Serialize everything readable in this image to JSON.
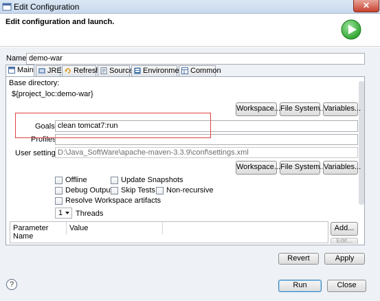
{
  "window": {
    "title": "Edit Configuration",
    "close_glyph": "✕"
  },
  "header": {
    "title": "Edit configuration and launch."
  },
  "name": {
    "label": "Name:",
    "value": "demo-war"
  },
  "tabs": [
    {
      "label": "Main",
      "icon": "main-tab-icon"
    },
    {
      "label": "JRE",
      "icon": "jre-tab-icon"
    },
    {
      "label": "Refresh",
      "icon": "refresh-tab-icon"
    },
    {
      "label": "Source",
      "icon": "source-tab-icon"
    },
    {
      "label": "Environment",
      "icon": "environment-tab-icon"
    },
    {
      "label": "Common",
      "icon": "common-tab-icon"
    }
  ],
  "main": {
    "base_dir_label": "Base directory:",
    "base_dir_value": "${project_loc:demo-war}",
    "workspace_btn": "Workspace...",
    "filesystem_btn": "File System...",
    "variables_btn": "Variables...",
    "goals_label": "Goals:",
    "goals_value": "clean tomcat7:run",
    "profiles_label": "Profiles:",
    "profiles_value": "",
    "user_settings_label": "User settings:",
    "user_settings_value": "D:\\Java_SoftWare\\apache-maven-3.3.9\\conf\\settings.xml",
    "checks": {
      "offline": "Offline",
      "update_snapshots": "Update Snapshots",
      "debug_output": "Debug Output",
      "skip_tests": "Skip Tests",
      "non_recursive": "Non-recursive",
      "resolve_workspace": "Resolve Workspace artifacts"
    },
    "threads_value": "1",
    "threads_label": "Threads",
    "table": {
      "col_param": "Parameter Name",
      "col_value": "Value"
    },
    "add_btn": "Add...",
    "edit_btn": "Edit..."
  },
  "footer": {
    "revert": "Revert",
    "apply": "Apply",
    "run": "Run",
    "close": "Close",
    "help": "?"
  },
  "colors": {
    "highlight_box": "#e04040",
    "run_badge": "#2fa42f"
  }
}
